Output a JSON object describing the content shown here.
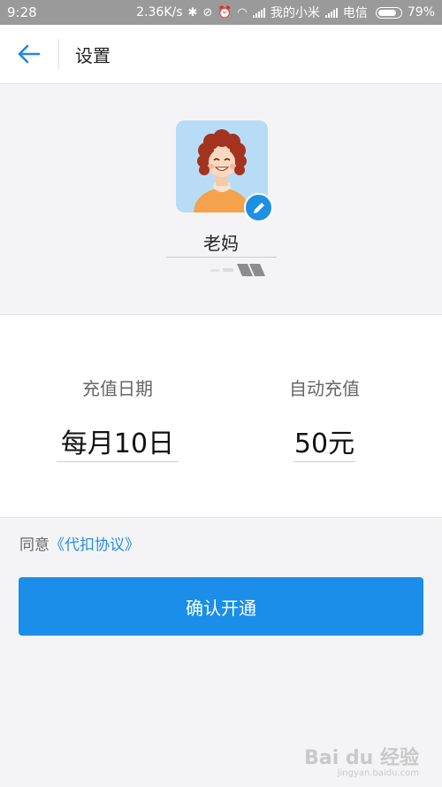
{
  "statusbar": {
    "time": "9:28",
    "speed": "2.36K/s",
    "carrier1": "我的小米",
    "carrier2": "电信",
    "battery": "79%"
  },
  "header": {
    "title": "设置"
  },
  "profile": {
    "name": "老妈"
  },
  "recharge": {
    "date_label": "充值日期",
    "date_value": "每月10日",
    "auto_label": "自动充值",
    "auto_value": "50元"
  },
  "agreement": {
    "prefix": "同意",
    "link": "《代扣协议》"
  },
  "actions": {
    "confirm_label": "确认开通"
  },
  "watermark": {
    "brand": "Bai du 经验",
    "url": "jingyan.baidu.com"
  },
  "colors": {
    "accent": "#1a8ee8",
    "link": "#2a8de0"
  },
  "icons": [
    "back-arrow-icon",
    "edit-pencil-icon",
    "bluetooth-icon",
    "alarm-icon",
    "wifi-icon",
    "signal-icon",
    "battery-icon"
  ]
}
